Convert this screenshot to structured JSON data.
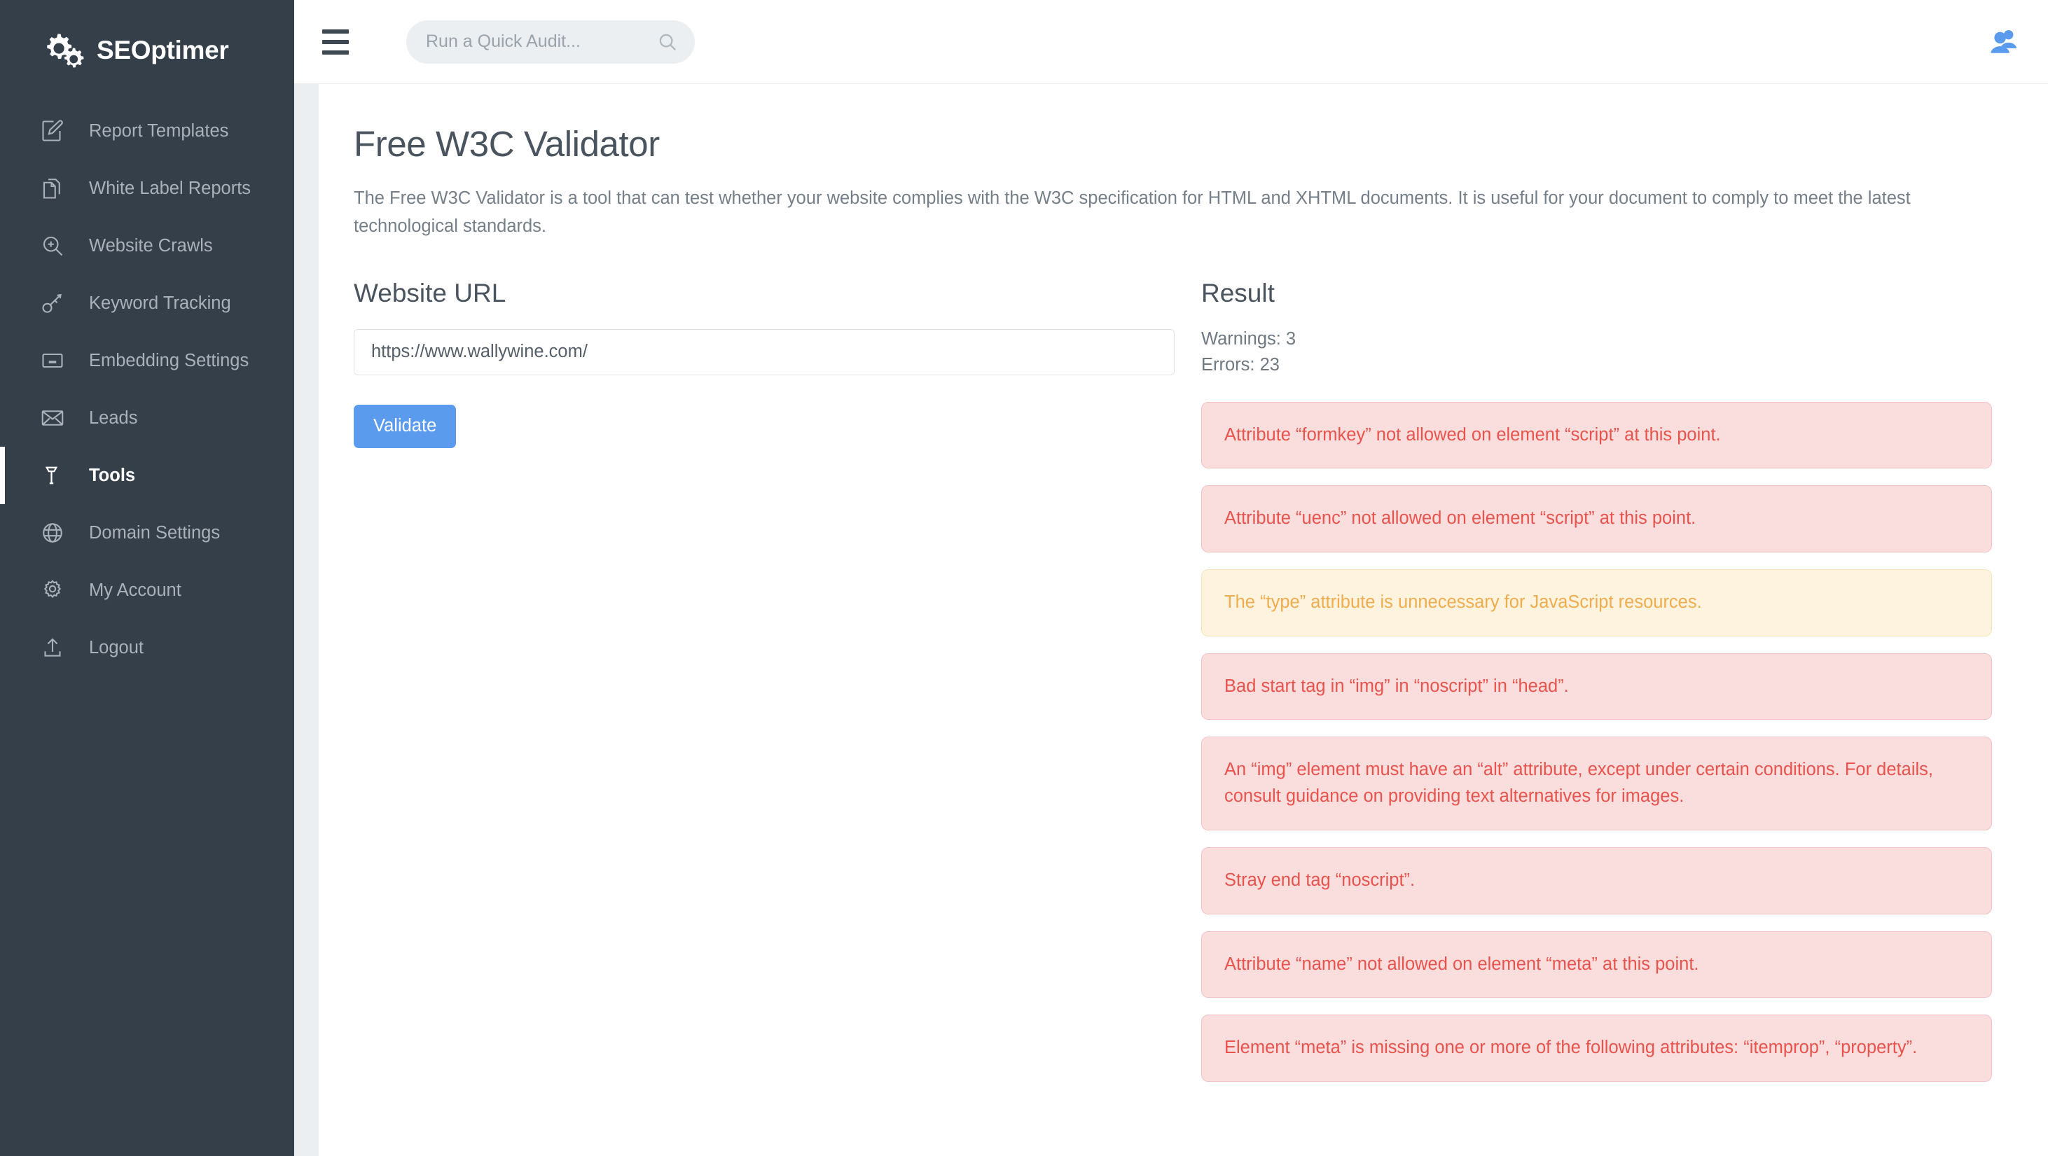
{
  "brand": {
    "name": "SEOptimer",
    "logo_icon": "gears-logo-icon"
  },
  "sidebar": {
    "items": [
      {
        "label": "Report Templates",
        "icon": "pencil-square-icon",
        "active": false
      },
      {
        "label": "White Label Reports",
        "icon": "documents-icon",
        "active": false
      },
      {
        "label": "Website Crawls",
        "icon": "magnifier-plus-icon",
        "active": false
      },
      {
        "label": "Keyword Tracking",
        "icon": "key-icon",
        "active": false
      },
      {
        "label": "Embedding Settings",
        "icon": "card-icon",
        "active": false
      },
      {
        "label": "Leads",
        "icon": "envelope-icon",
        "active": false
      },
      {
        "label": "Tools",
        "icon": "hammer-icon",
        "active": true
      },
      {
        "label": "Domain Settings",
        "icon": "globe-icon",
        "active": false
      },
      {
        "label": "My Account",
        "icon": "gear-icon",
        "active": false
      },
      {
        "label": "Logout",
        "icon": "export-upload-icon",
        "active": false
      }
    ]
  },
  "topbar": {
    "menu_icon": "hamburger-icon",
    "search": {
      "placeholder": "Run a Quick Audit...",
      "value": "",
      "icon": "search-icon"
    },
    "users_icon": "users-icon"
  },
  "page": {
    "title": "Free W3C Validator",
    "description": "The Free W3C Validator is a tool that can test whether your website complies with the W3C specification for HTML and XHTML documents. It is useful for your document to comply to meet the latest technological standards."
  },
  "form": {
    "label": "Website URL",
    "url_value": "https://www.wallywine.com/",
    "url_placeholder": "",
    "submit_label": "Validate"
  },
  "result": {
    "title": "Result",
    "warnings_text": "Warnings: 3",
    "errors_text": "Errors: 23",
    "warnings_count": 3,
    "errors_count": 23,
    "messages": [
      {
        "type": "error",
        "text": "Attribute “formkey” not allowed on element “script” at this point."
      },
      {
        "type": "error",
        "text": "Attribute “uenc” not allowed on element “script” at this point."
      },
      {
        "type": "warning",
        "text": "The “type” attribute is unnecessary for JavaScript resources."
      },
      {
        "type": "error",
        "text": "Bad start tag in “img” in “noscript” in “head”."
      },
      {
        "type": "error",
        "text": "An “img” element must have an “alt” attribute, except under certain conditions. For details, consult guidance on providing text alternatives for images."
      },
      {
        "type": "error",
        "text": "Stray end tag “noscript”."
      },
      {
        "type": "error",
        "text": "Attribute “name” not allowed on element “meta” at this point."
      },
      {
        "type": "error",
        "text": "Element “meta” is missing one or more of the following attributes: “itemprop”, “property”."
      }
    ]
  },
  "colors": {
    "sidebar_bg": "#353f4a",
    "accent_blue": "#5b9bed",
    "error_bg": "#fadddd",
    "error_text": "#e8544d",
    "warning_bg": "#fdf3de",
    "warning_text": "#f0ad4e",
    "gutter": "#eceff1"
  }
}
